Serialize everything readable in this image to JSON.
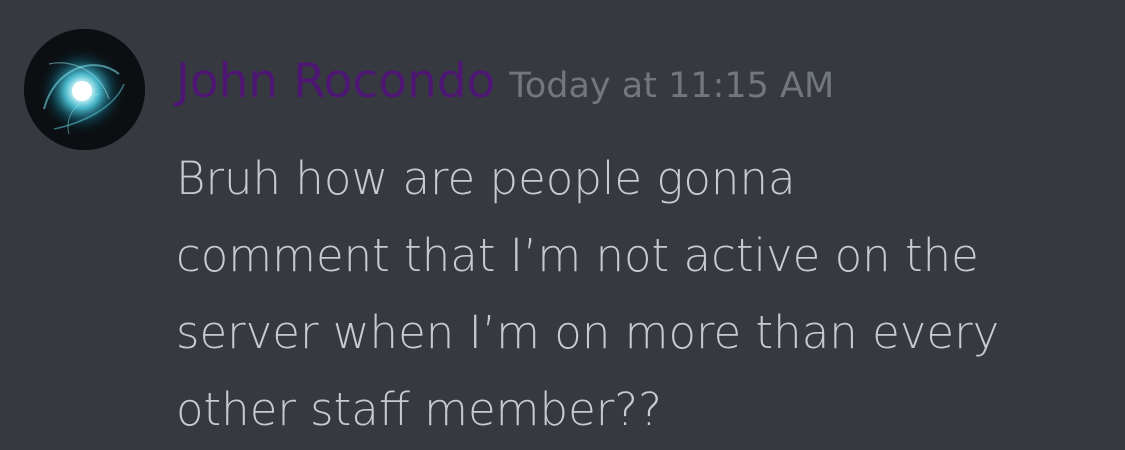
{
  "message": {
    "author": "John Rocondo",
    "timestamp": "Today at 11:15 AM",
    "content_lines": [
      "Bruh how are people gonna",
      "comment that I’m not active on the",
      "server when I’m on more than every",
      "other staff member??"
    ]
  },
  "colors": {
    "background": "#36393f",
    "author_name": "#4e1673",
    "timestamp": "#72767d",
    "message_text": "#c8cacd"
  },
  "icons": {
    "avatar": "glowing-orb-avatar"
  }
}
